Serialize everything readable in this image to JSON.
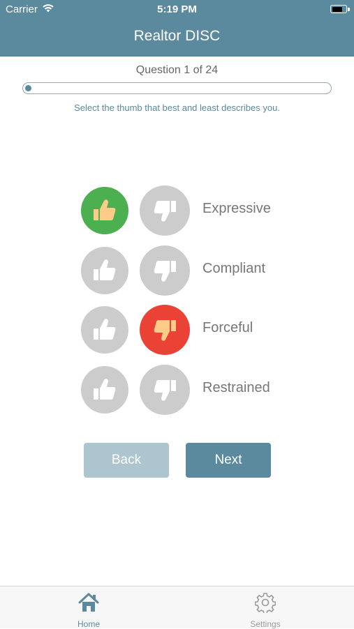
{
  "status_bar": {
    "carrier": "Carrier",
    "time": "5:19 PM",
    "icons": [
      "wifi-icon",
      "battery-icon"
    ]
  },
  "nav": {
    "title": "Realtor DISC"
  },
  "question": {
    "label": "Question 1 of 24",
    "current": 1,
    "total": 24,
    "instructions": "Select the thumb that best and least describes you."
  },
  "options": [
    {
      "label": "Expressive",
      "most": true,
      "least": false
    },
    {
      "label": "Compliant",
      "most": false,
      "least": false
    },
    {
      "label": "Forceful",
      "most": false,
      "least": true
    },
    {
      "label": "Restrained",
      "most": false,
      "least": false
    }
  ],
  "buttons": {
    "back_label": "Back",
    "next_label": "Next"
  },
  "tabs": [
    {
      "label": "Home",
      "icon": "home-icon",
      "active": true
    },
    {
      "label": "Settings",
      "icon": "gear-icon",
      "active": false
    }
  ],
  "colors": {
    "brand": "#5b899d",
    "selected_most": "#4caf50",
    "selected_least": "#ea4335",
    "unselected": "#cccccc",
    "thumb_skin": "#fecb89",
    "back_disabled": "#adc5cf"
  }
}
